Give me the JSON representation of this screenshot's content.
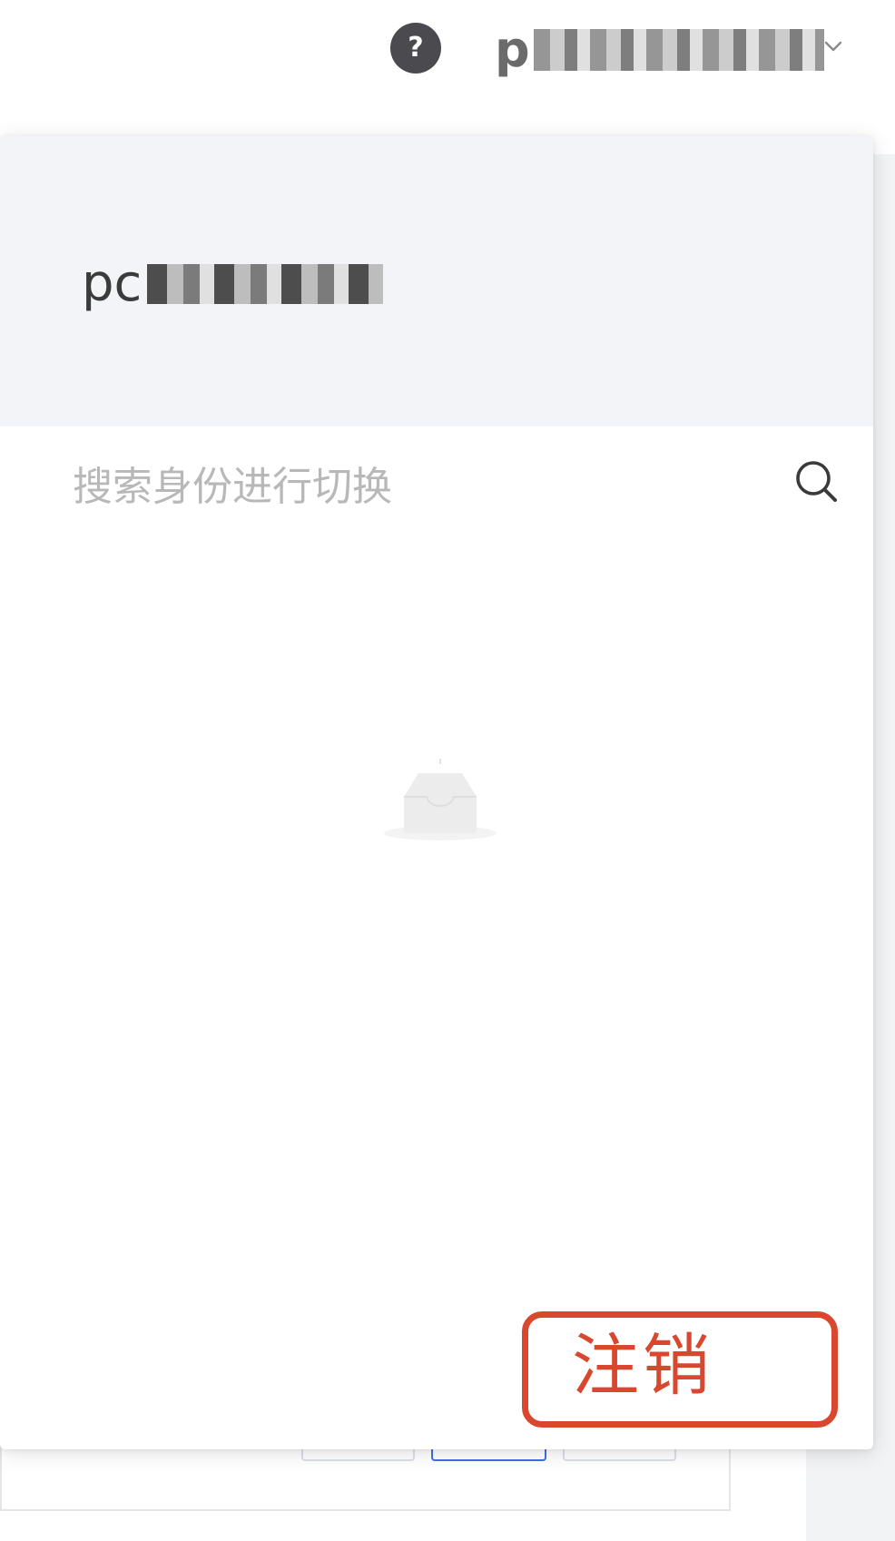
{
  "header": {
    "help_icon": "question-circle-icon",
    "help_glyph": "?",
    "user_name_prefix": "p",
    "dropdown_icon": "chevron-down-icon"
  },
  "dropdown": {
    "identity_prefix": "pc",
    "search": {
      "placeholder": "搜索身份进行切换",
      "value": "",
      "icon": "search-icon"
    },
    "empty_state_icon": "empty-inbox-icon",
    "logout_label": "注销"
  },
  "colors": {
    "accent_red": "#d9472e",
    "header_bg": "#f3f4f8",
    "help_icon_bg": "#4a4a4f",
    "placeholder": "#b8b8b8"
  }
}
